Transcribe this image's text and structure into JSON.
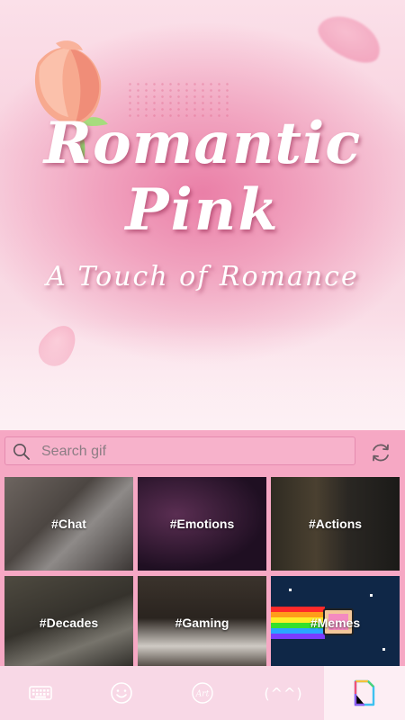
{
  "theme": {
    "title_line1": "Romantic",
    "title_line2": "Pink",
    "tagline": "A Touch of Romance"
  },
  "gif_panel": {
    "search": {
      "placeholder": "Search gif",
      "value": ""
    },
    "categories": [
      {
        "label": "#Chat"
      },
      {
        "label": "#Emotions"
      },
      {
        "label": "#Actions"
      },
      {
        "label": "#Decades"
      },
      {
        "label": "#Gaming"
      },
      {
        "label": "#Memes"
      }
    ]
  },
  "toolbar": {
    "items": [
      {
        "icon": "keyboard-icon"
      },
      {
        "icon": "emoji-icon"
      },
      {
        "icon": "art-sticker-icon",
        "text": "Art"
      },
      {
        "icon": "kaomoji-icon",
        "text": "(^^)"
      },
      {
        "icon": "gif-icon",
        "active": true
      }
    ]
  },
  "colors": {
    "panel_bg": "#f6a8c4",
    "toolbar_bg": "#f8d8e6",
    "accent": "#ea7fa7"
  }
}
